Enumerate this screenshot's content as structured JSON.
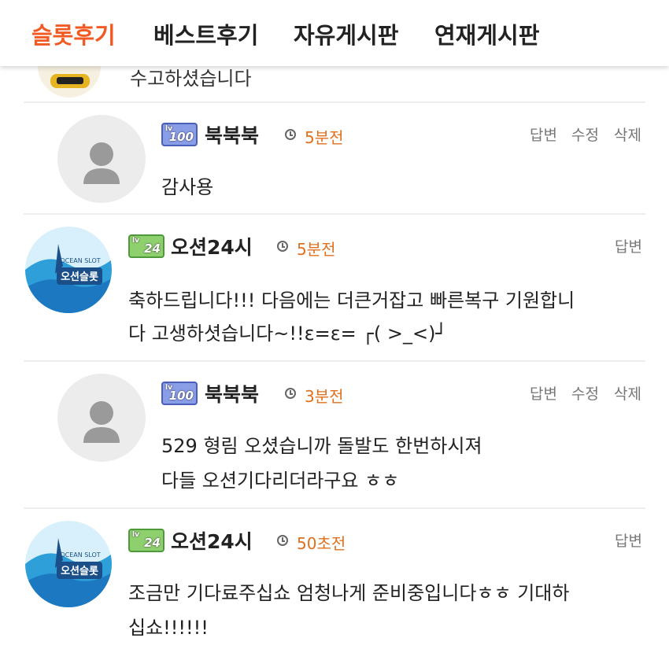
{
  "nav": {
    "tabs": [
      {
        "label": "슬롯후기",
        "active": true
      },
      {
        "label": "베스트후기",
        "active": false
      },
      {
        "label": "자유게시판",
        "active": false
      },
      {
        "label": "연재게시판",
        "active": false
      }
    ]
  },
  "partial_comment": {
    "text": "수고하셨습니다"
  },
  "comments": [
    {
      "level": "100",
      "level_prefix": "lv",
      "author": "북북북",
      "time": "5분전",
      "actions": [
        "답변",
        "수정",
        "삭제"
      ],
      "lines": [
        "감사용"
      ]
    },
    {
      "level": "24",
      "level_prefix": "lv",
      "author": "오션24시",
      "time": "5분전",
      "actions": [
        "답변"
      ],
      "lines": [
        "축하드립니다!!! 다음에는 더큰거잡고 빠른복구 기원합니",
        "다 고생하셧습니다~!!ε=ε= ┌( >_<)┘"
      ]
    },
    {
      "level": "100",
      "level_prefix": "lv",
      "author": "북북북",
      "time": "3분전",
      "actions": [
        "답변",
        "수정",
        "삭제"
      ],
      "lines": [
        "529 형림 오셨습니까 돌발도 한번하시져",
        "다들 오션기다리더라구요 ㅎㅎ"
      ]
    },
    {
      "level": "24",
      "level_prefix": "lv",
      "author": "오션24시",
      "time": "50초전",
      "actions": [
        "답변"
      ],
      "lines": [
        "조금만 기다료주십쇼 엄청나게 준비중입니다ㅎㅎ 기대하",
        "십쇼!!!!!!"
      ]
    }
  ],
  "avatar_logo_text": [
    "OCEAN SLOT",
    "오션슬롯"
  ],
  "colors": {
    "accent": "#f15a22",
    "time": "#e0701e"
  }
}
